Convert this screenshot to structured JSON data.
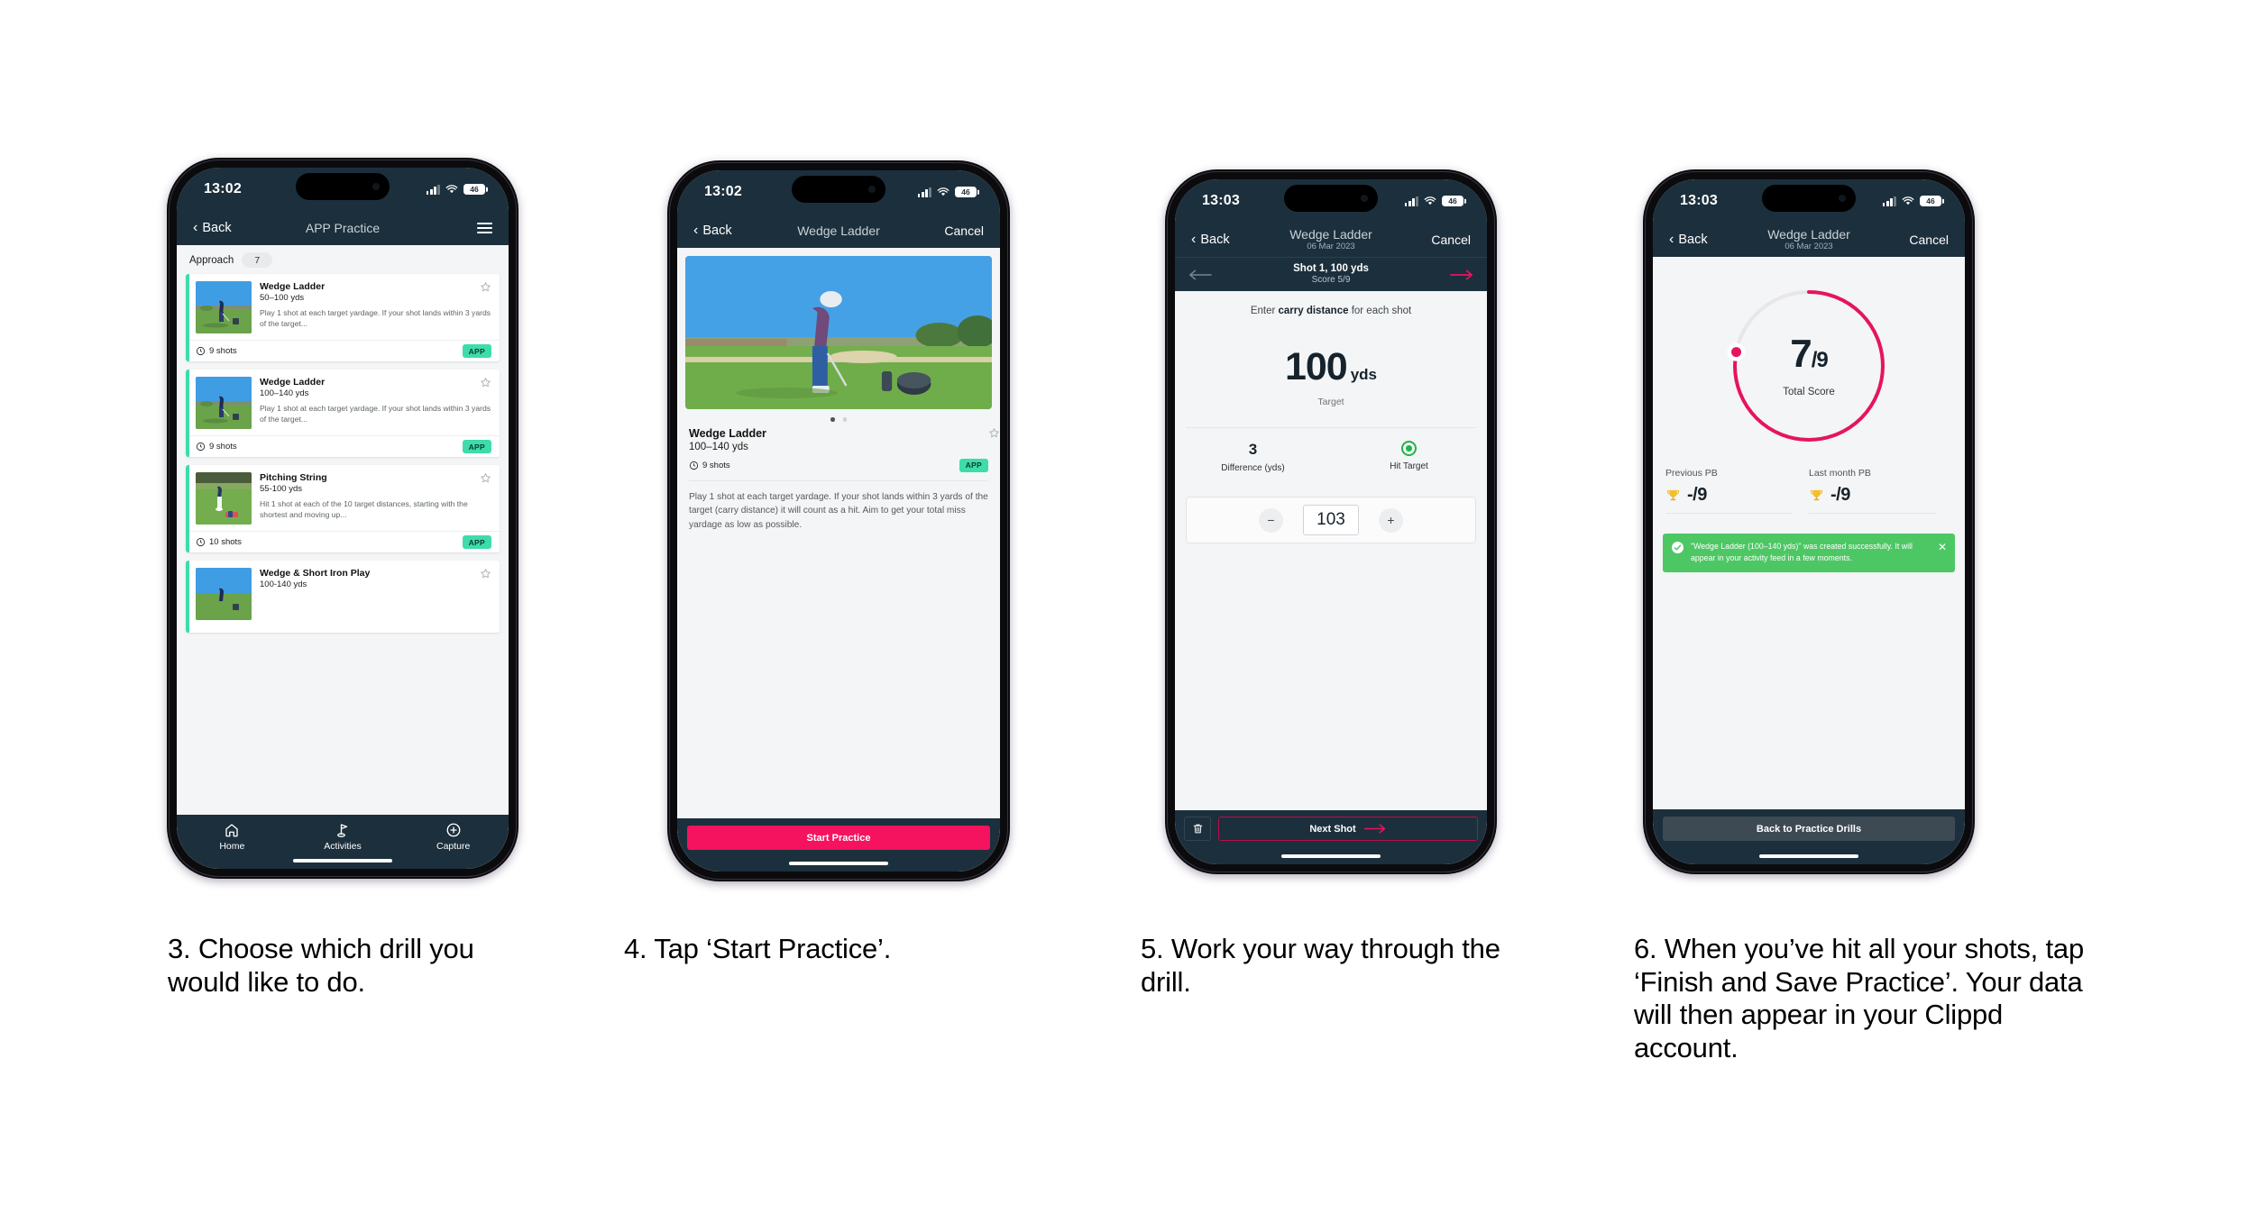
{
  "colors": {
    "navy": "#1c2f3c",
    "teal": "#3ddcaa",
    "pink": "#f5125e",
    "green": "#4cc764",
    "hit_green": "#1fb44a"
  },
  "phone1": {
    "status": {
      "time": "13:02",
      "battery": "46"
    },
    "nav": {
      "back": "Back",
      "title": "APP Practice"
    },
    "filter": {
      "label": "Approach",
      "count": "7"
    },
    "cards": [
      {
        "title": "Wedge Ladder",
        "range": "50–100 yds",
        "desc": "Play 1 shot at each target yardage. If your shot lands within 3 yards of the target...",
        "shots": "9 shots",
        "badge": "APP"
      },
      {
        "title": "Wedge Ladder",
        "range": "100–140 yds",
        "desc": "Play 1 shot at each target yardage. If your shot lands within 3 yards of the target...",
        "shots": "9 shots",
        "badge": "APP"
      },
      {
        "title": "Pitching String",
        "range": "55-100 yds",
        "desc": "Hit 1 shot at each of the 10 target distances, starting with the shortest and moving up...",
        "shots": "10 shots",
        "badge": "APP"
      },
      {
        "title": "Wedge & Short Iron Play",
        "range": "100-140 yds",
        "desc": "",
        "shots": "",
        "badge": ""
      }
    ],
    "tabs": [
      {
        "label": "Home",
        "icon": "home-icon"
      },
      {
        "label": "Activities",
        "icon": "golf-flag-icon"
      },
      {
        "label": "Capture",
        "icon": "plus-circle-icon"
      }
    ]
  },
  "phone2": {
    "status": {
      "time": "13:02",
      "battery": "46"
    },
    "nav": {
      "back": "Back",
      "title": "Wedge Ladder",
      "cancel": "Cancel"
    },
    "drill": {
      "title": "Wedge Ladder",
      "range": "100–140 yds",
      "shots": "9 shots",
      "badge": "APP",
      "description": "Play 1 shot at each target yardage. If your shot lands within 3 yards of the target (carry distance) it will count as a hit. Aim to get your total miss yardage as low as possible."
    },
    "cta": "Start Practice"
  },
  "phone3": {
    "status": {
      "time": "13:03",
      "battery": "46"
    },
    "nav": {
      "back": "Back",
      "title": "Wedge Ladder",
      "subtitle": "06 Mar 2023",
      "cancel": "Cancel"
    },
    "shotbar": {
      "title": "Shot 1, 100 yds",
      "score": "Score 5/9"
    },
    "prompt_pre": "Enter ",
    "prompt_bold": "carry distance",
    "prompt_post": " for each shot",
    "target": {
      "value": "100",
      "unit": "yds",
      "label": "Target"
    },
    "stats": [
      {
        "value": "3",
        "label": "Difference (yds)"
      },
      {
        "value": "",
        "label": "Hit Target"
      }
    ],
    "stepper": {
      "minus": "−",
      "value": "103",
      "plus": "+"
    },
    "footer": {
      "next": "Next Shot"
    }
  },
  "phone4": {
    "status": {
      "time": "13:03",
      "battery": "46"
    },
    "nav": {
      "back": "Back",
      "title": "Wedge Ladder",
      "subtitle": "06 Mar 2023",
      "cancel": "Cancel"
    },
    "ring": {
      "score": "7",
      "slash": "/",
      "denominator": "9",
      "label": "Total Score",
      "percent": 78
    },
    "pbs": [
      {
        "label": "Previous PB",
        "value": "-/9"
      },
      {
        "label": "Last month PB",
        "value": "-/9"
      }
    ],
    "toast": {
      "message": "\"Wedge Ladder (100–140 yds)\" was created successfully. It will appear in your activity feed in a few moments.",
      "close": "✕"
    },
    "footer": {
      "button": "Back to Practice Drills"
    }
  },
  "captions": [
    "3. Choose which drill you would like to do.",
    "4. Tap ‘Start Practice’.",
    "5. Work your way through the drill.",
    "6. When you’ve hit all your shots, tap ‘Finish and Save Practice’. Your data will then appear in your Clippd account."
  ]
}
